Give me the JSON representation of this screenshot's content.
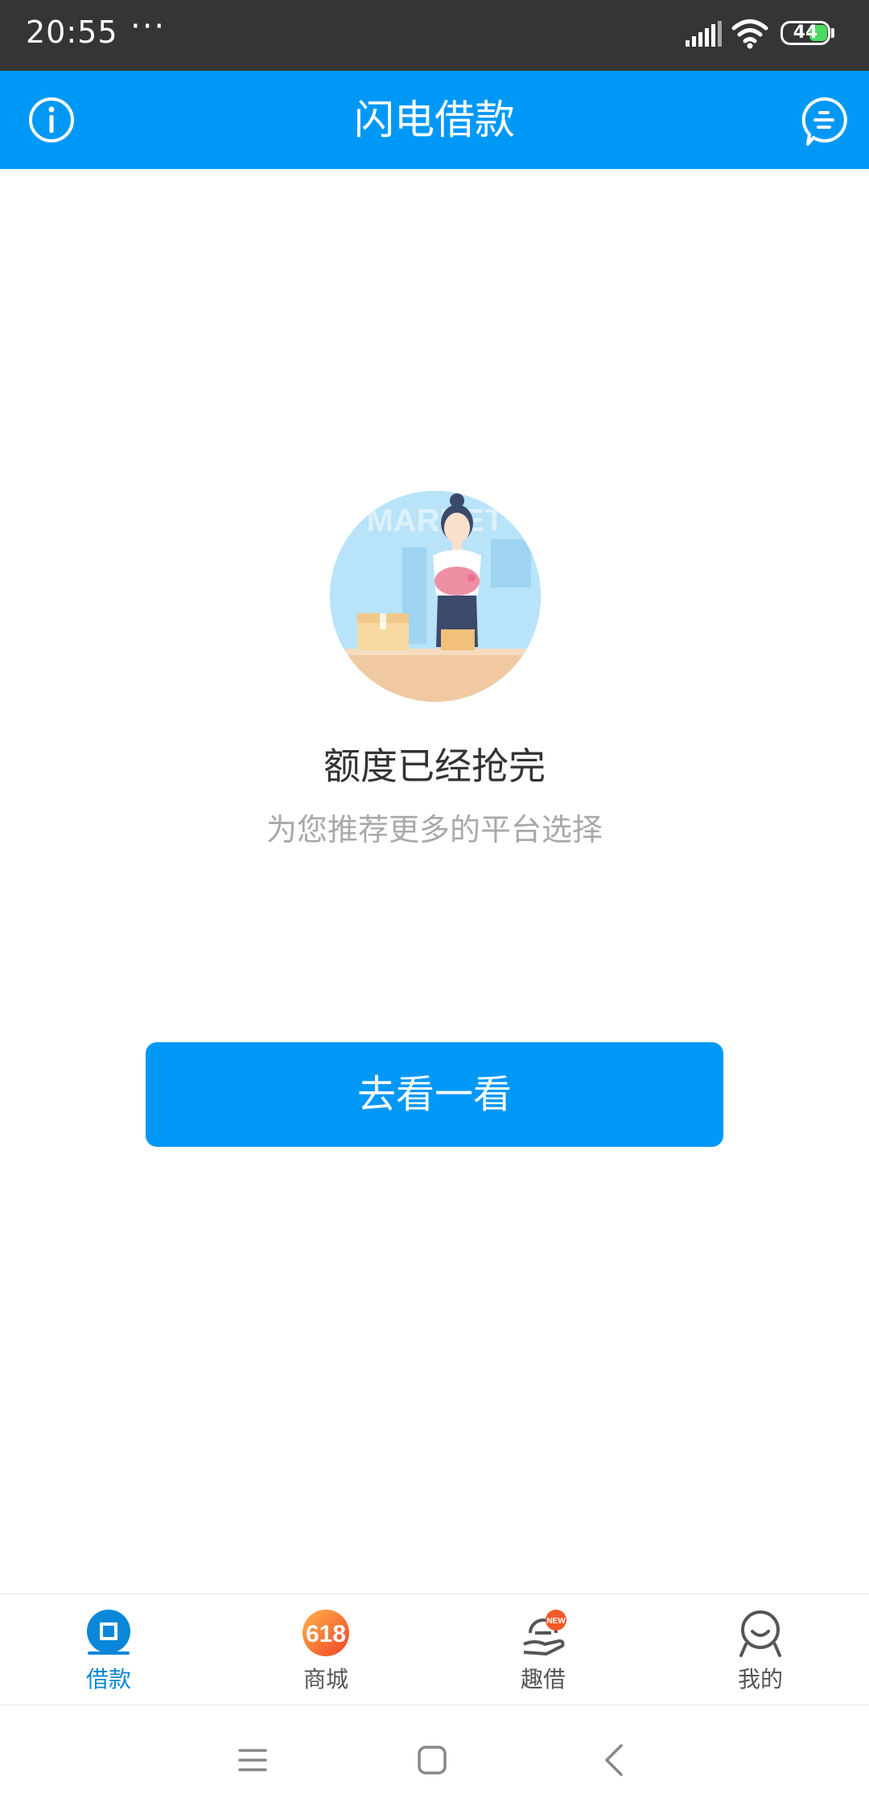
{
  "status_bar": {
    "time": "20:55",
    "overflow": "···",
    "battery": "44",
    "battery_color": "#4cd964",
    "icons": [
      "signal-icon",
      "wifi-icon",
      "battery-icon"
    ]
  },
  "header": {
    "title": "闪电借款",
    "left_icon": "info-icon",
    "right_icon": "chat-icon",
    "background": "#0098f7"
  },
  "main": {
    "title": "额度已经抢完",
    "subtitle": "为您推荐更多的平台选择",
    "button_label": "去看一看",
    "illustration_text": "MARKET",
    "accent": "#0098f7"
  },
  "tabbar": {
    "items": [
      {
        "label": "借款",
        "icon": "loan-icon",
        "active": true
      },
      {
        "label": "商城",
        "icon": "mall-618-icon",
        "badge": "618",
        "active": false
      },
      {
        "label": "趣借",
        "icon": "fun-loan-icon",
        "badge": "NEW",
        "active": false
      },
      {
        "label": "我的",
        "icon": "profile-icon",
        "active": false
      }
    ],
    "active_color": "#0a87d8"
  },
  "navbar": {
    "icons": [
      "menu-icon",
      "home-icon",
      "back-icon"
    ]
  }
}
